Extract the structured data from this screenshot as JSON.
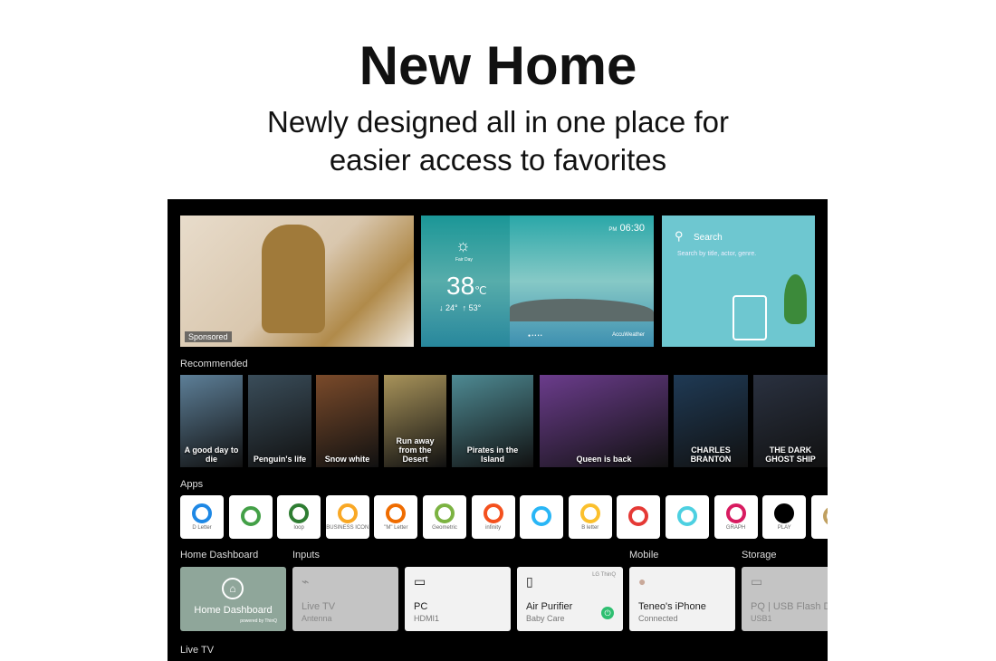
{
  "headline": "New Home",
  "subtitle_line1": "Newly designed all in one place for",
  "subtitle_line2": "easier access to favorites",
  "hero": {
    "sponsored": "Sponsored",
    "weather": {
      "condition": "Fair Day",
      "temp": "38",
      "unit": "℃",
      "low": "↓ 24°",
      "high": "↑ 53°",
      "time_prefix": "PM",
      "time": "06:30",
      "provider": "AccuWeather"
    },
    "search": {
      "title": "Search",
      "hint": "Search by title, actor, genre."
    }
  },
  "sections": {
    "recommended": "Recommended",
    "apps": "Apps",
    "home_dashboard": "Home Dashboard",
    "inputs": "Inputs",
    "mobile": "Mobile",
    "storage": "Storage",
    "live_tv": "Live TV"
  },
  "recommended": [
    {
      "title": "A good day to die",
      "color": "#5d7f98"
    },
    {
      "title": "Penguin's life",
      "color": "#3a4d5a"
    },
    {
      "title": "Snow white",
      "color": "#7a4a2a"
    },
    {
      "title": "Run away from the Desert",
      "color": "#a8935a"
    },
    {
      "title": "Pirates in the Island",
      "color": "#4e8a93"
    },
    {
      "title": "Queen is back",
      "color": "#6b3c8c"
    },
    {
      "title": "CHARLES BRANTON",
      "color": "#1f3a55"
    },
    {
      "title": "THE DARK GHOST SHIP",
      "color": "#2a3140"
    }
  ],
  "apps": [
    {
      "label": "D Letter",
      "color": "#1e88e5"
    },
    {
      "label": "",
      "color": "#43a047"
    },
    {
      "label": "loop",
      "color": "#2e7d32"
    },
    {
      "label": "BUSINESS ICON",
      "color": "#f9a825"
    },
    {
      "label": "\"M\" Letter",
      "color": "#ef6c00"
    },
    {
      "label": "Geometric",
      "color": "#7cb342"
    },
    {
      "label": "infinity",
      "color": "#f4511e"
    },
    {
      "label": "",
      "color": "#29b6f6"
    },
    {
      "label": "B letter",
      "color": "#fbc02d"
    },
    {
      "label": "",
      "color": "#e53935"
    },
    {
      "label": "",
      "color": "#4dd0e1"
    },
    {
      "label": "GRAPH",
      "color": "#d81b60"
    },
    {
      "label": "PLAY",
      "color": "#000000"
    },
    {
      "label": "",
      "color": "#c0a060"
    }
  ],
  "dashboard": {
    "home": {
      "title": "Home Dashboard",
      "powered": "powered by ThinQ"
    },
    "cards": [
      {
        "title": "Live TV",
        "sub": "Antenna",
        "dim": true,
        "icon": "antenna-icon"
      },
      {
        "title": "PC",
        "sub": "HDMI1",
        "dim": false,
        "icon": "laptop-icon"
      },
      {
        "title": "Air Purifier",
        "sub": "Baby Care",
        "dim": false,
        "icon": "purifier-icon",
        "badge": "LG ThinQ"
      },
      {
        "title": "Teneo's iPhone",
        "sub": "Connected",
        "dim": false,
        "icon": "avatar"
      },
      {
        "title": "PQ | USB Flash D",
        "sub": "USB1",
        "dim": true,
        "icon": "usb-icon"
      }
    ]
  },
  "colors": {
    "accent_green": "#2fbf71",
    "home_card": "#8fa69a"
  }
}
